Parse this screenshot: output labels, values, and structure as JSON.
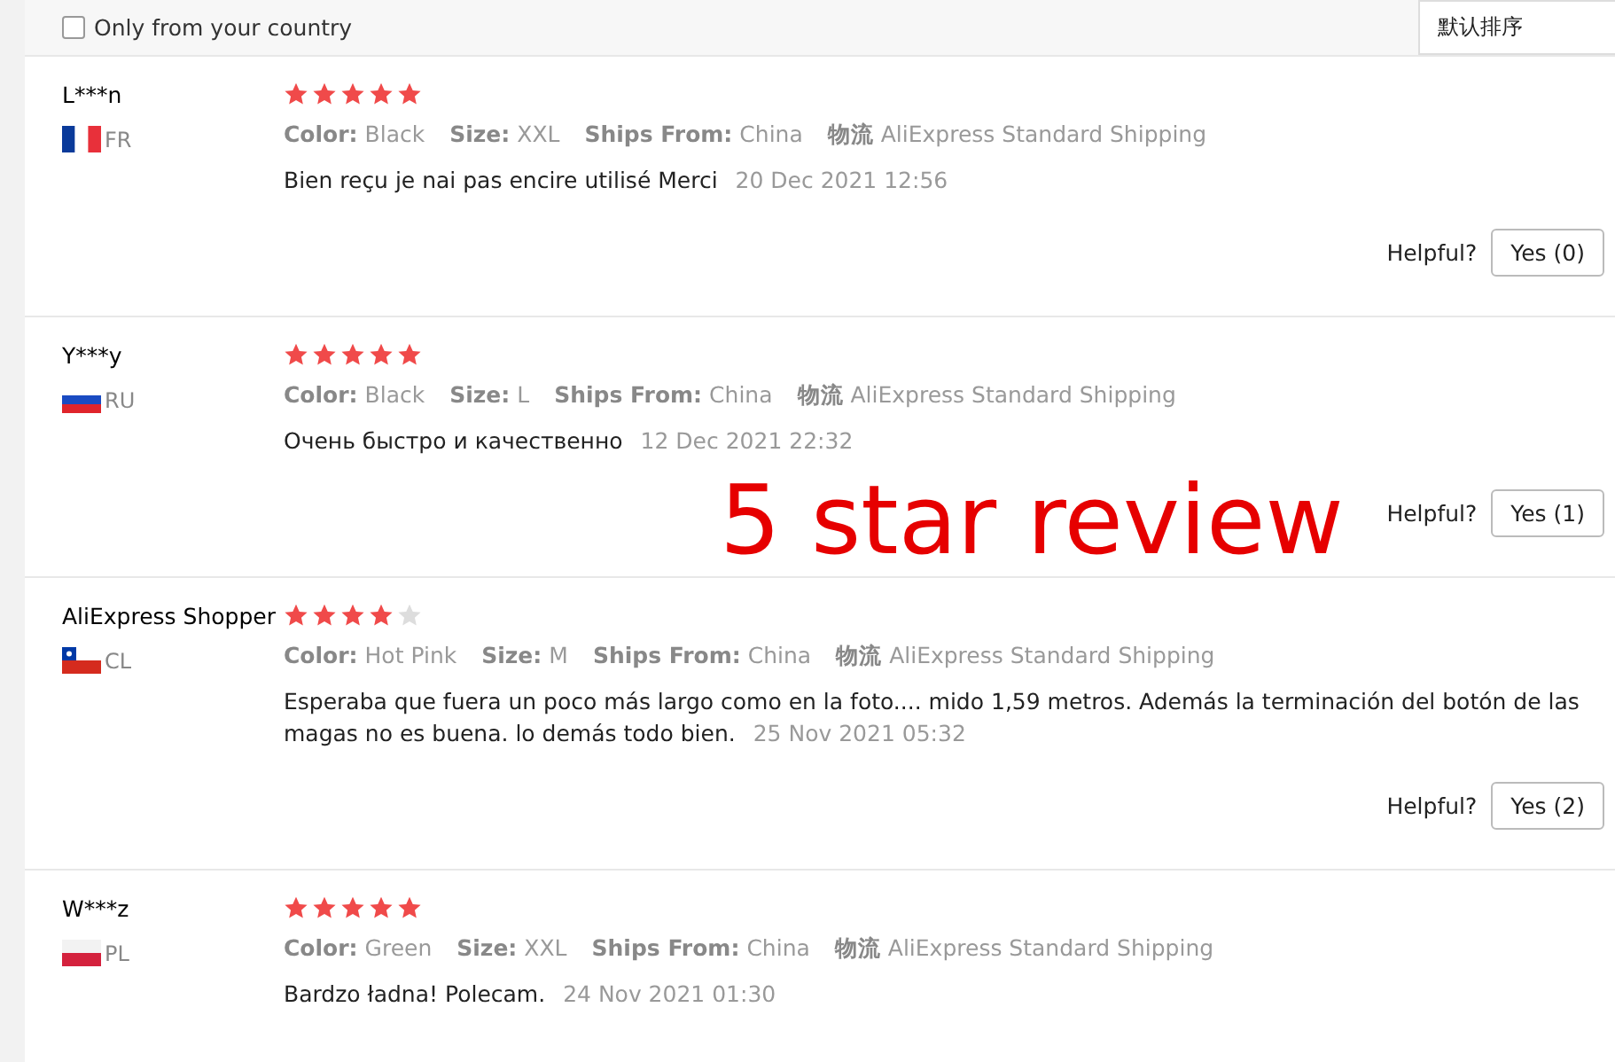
{
  "filter": {
    "label": "Only from your country",
    "checked": false
  },
  "sort": {
    "value": "默认排序"
  },
  "reviews": [
    {
      "name": "L***n",
      "kind": "fr",
      "country": "FR",
      "stars": 5,
      "meta": [
        {
          "label": "Color:",
          "value": "Black"
        },
        {
          "label": "Size:",
          "value": "XXL"
        },
        {
          "label": "Ships From:",
          "value": "China"
        },
        {
          "label": "物流",
          "value": "AliExpress Standard Shipping"
        }
      ],
      "text": "Bien reçu je nai pas encire utilisé Merci",
      "date": "20 Dec 2021 12:56",
      "helpful": {
        "label": "Helpful?",
        "button": "Yes (0)"
      }
    },
    {
      "name": "Y***y",
      "kind": "ru",
      "country": "RU",
      "stars": 5,
      "meta": [
        {
          "label": "Color:",
          "value": "Black"
        },
        {
          "label": "Size:",
          "value": "L"
        },
        {
          "label": "Ships From:",
          "value": "China"
        },
        {
          "label": "物流",
          "value": "AliExpress Standard Shipping"
        }
      ],
      "text": "Очень быстро и качественно",
      "date": "12 Dec 2021 22:32",
      "helpful": {
        "label": "Helpful?",
        "button": "Yes (1)"
      }
    },
    {
      "name": "AliExpress Shopper",
      "kind": "cl",
      "country": "CL",
      "stars": 4,
      "meta": [
        {
          "label": "Color:",
          "value": "Hot Pink"
        },
        {
          "label": "Size:",
          "value": "M"
        },
        {
          "label": "Ships From:",
          "value": "China"
        },
        {
          "label": "物流",
          "value": "AliExpress Standard Shipping"
        }
      ],
      "text": "Esperaba que fuera un poco más largo como en la foto.... mido 1,59 metros. Además la terminación del botón de las magas no es buena. lo demás todo bien.",
      "date": "25 Nov 2021 05:32",
      "helpful": {
        "label": "Helpful?",
        "button": "Yes (2)"
      }
    },
    {
      "name": "W***z",
      "kind": "pl",
      "country": "PL",
      "stars": 5,
      "meta": [
        {
          "label": "Color:",
          "value": "Green"
        },
        {
          "label": "Size:",
          "value": "XXL"
        },
        {
          "label": "Ships From:",
          "value": "China"
        },
        {
          "label": "物流",
          "value": "AliExpress Standard Shipping"
        }
      ],
      "text": "Bardzo ładna! Polecam.",
      "date": "24 Nov 2021 01:30"
    }
  ],
  "annotation": "5 star review"
}
